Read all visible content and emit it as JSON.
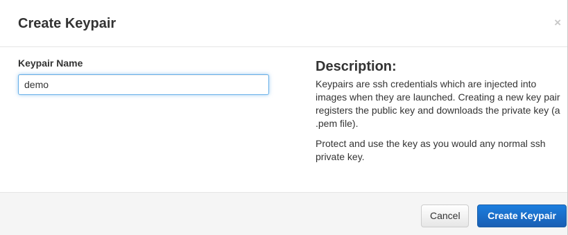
{
  "dialog": {
    "title": "Create Keypair",
    "close_label": "×"
  },
  "form": {
    "keypair_name_label": "Keypair Name",
    "keypair_name_value": "demo",
    "keypair_name_placeholder": ""
  },
  "description": {
    "title": "Description:",
    "paragraph_1": "Keypairs are ssh credentials which are injected into images when they are launched. Creating a new key pair registers the public key and downloads the private key (a .pem file).",
    "paragraph_2": "Protect and use the key as you would any normal ssh private key."
  },
  "footer": {
    "cancel_label": "Cancel",
    "submit_label": "Create Keypair"
  },
  "colors": {
    "primary": "#1a6fcc",
    "focus_border": "#66afe9",
    "footer_bg": "#f5f5f5"
  }
}
